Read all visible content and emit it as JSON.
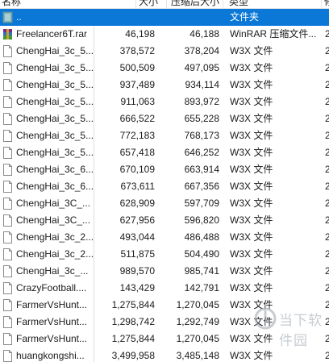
{
  "header": {
    "name": "名称",
    "size": "大小",
    "packed": "压缩后大小",
    "type": "类型",
    "extra": "修"
  },
  "rows": [
    {
      "name": "..",
      "size": "",
      "packed": "",
      "type": "文件夹",
      "extra": "",
      "icon": "folder-icon",
      "selected": true
    },
    {
      "name": "Freelancer6T.rar",
      "size": "46,198",
      "packed": "46,188",
      "type": "WinRAR 压缩文件...",
      "extra": "2",
      "icon": "rar-archive-icon"
    },
    {
      "name": "ChengHai_3c_5...",
      "size": "378,572",
      "packed": "378,204",
      "type": "W3X 文件",
      "extra": "2",
      "icon": "file-icon"
    },
    {
      "name": "ChengHai_3c_5...",
      "size": "500,509",
      "packed": "497,095",
      "type": "W3X 文件",
      "extra": "2",
      "icon": "file-icon"
    },
    {
      "name": "ChengHai_3c_5...",
      "size": "937,489",
      "packed": "934,114",
      "type": "W3X 文件",
      "extra": "2",
      "icon": "file-icon"
    },
    {
      "name": "ChengHai_3c_5...",
      "size": "911,063",
      "packed": "893,972",
      "type": "W3X 文件",
      "extra": "2",
      "icon": "file-icon"
    },
    {
      "name": "ChengHai_3c_5...",
      "size": "666,522",
      "packed": "655,228",
      "type": "W3X 文件",
      "extra": "2",
      "icon": "file-icon"
    },
    {
      "name": "ChengHai_3c_5...",
      "size": "772,183",
      "packed": "768,173",
      "type": "W3X 文件",
      "extra": "2",
      "icon": "file-icon"
    },
    {
      "name": "ChengHai_3c_5...",
      "size": "657,418",
      "packed": "646,252",
      "type": "W3X 文件",
      "extra": "2",
      "icon": "file-icon"
    },
    {
      "name": "ChengHai_3c_6...",
      "size": "670,109",
      "packed": "663,914",
      "type": "W3X 文件",
      "extra": "2",
      "icon": "file-icon"
    },
    {
      "name": "ChengHai_3c_6...",
      "size": "673,611",
      "packed": "667,356",
      "type": "W3X 文件",
      "extra": "2",
      "icon": "file-icon"
    },
    {
      "name": "ChengHai_3C_...",
      "size": "628,909",
      "packed": "597,709",
      "type": "W3X 文件",
      "extra": "2",
      "icon": "file-icon"
    },
    {
      "name": "ChengHai_3C_...",
      "size": "627,956",
      "packed": "596,820",
      "type": "W3X 文件",
      "extra": "2",
      "icon": "file-icon"
    },
    {
      "name": "ChengHai_3c_2...",
      "size": "493,044",
      "packed": "486,488",
      "type": "W3X 文件",
      "extra": "2",
      "icon": "file-icon"
    },
    {
      "name": "ChengHai_3c_2...",
      "size": "511,875",
      "packed": "504,490",
      "type": "W3X 文件",
      "extra": "2",
      "icon": "file-icon"
    },
    {
      "name": "ChengHai_3c_...",
      "size": "989,570",
      "packed": "985,741",
      "type": "W3X 文件",
      "extra": "2",
      "icon": "file-icon"
    },
    {
      "name": "CrazyFootball....",
      "size": "143,429",
      "packed": "142,791",
      "type": "W3X 文件",
      "extra": "2",
      "icon": "file-icon"
    },
    {
      "name": "FarmerVsHunt...",
      "size": "1,275,844",
      "packed": "1,270,045",
      "type": "W3X 文件",
      "extra": "2",
      "icon": "file-icon"
    },
    {
      "name": "FarmerVsHunt...",
      "size": "1,298,742",
      "packed": "1,292,749",
      "type": "W3X 文件",
      "extra": "2",
      "icon": "file-icon"
    },
    {
      "name": "FarmerVsHunt...",
      "size": "1,275,844",
      "packed": "1,270,045",
      "type": "W3X 文件",
      "extra": "2",
      "icon": "file-icon"
    },
    {
      "name": "huangkongshi...",
      "size": "3,499,958",
      "packed": "3,485,148",
      "type": "W3X 文件",
      "extra": "2",
      "icon": "file-icon"
    }
  ],
  "watermark": {
    "text": "当下软件园",
    "icon": "watermark-logo-icon"
  },
  "colors": {
    "selection": "#0b78d7",
    "separator": "#e0e0e0"
  }
}
